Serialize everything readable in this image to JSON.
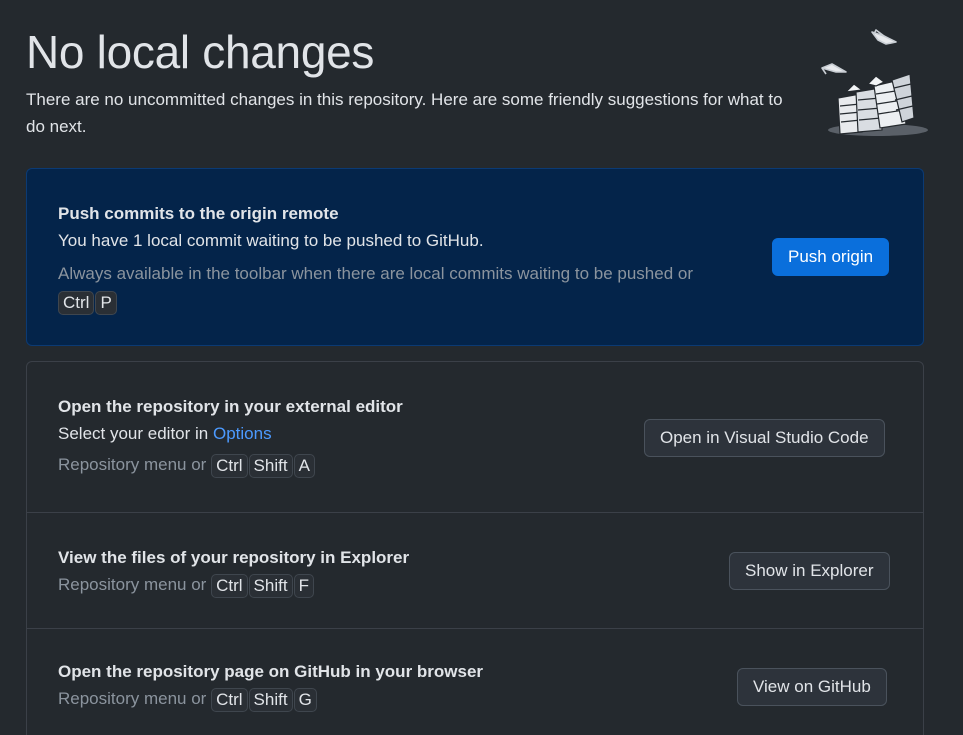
{
  "header": {
    "title": "No local changes",
    "subtitle": "There are no uncommitted changes in this repository. Here are some friendly suggestions for what to do next."
  },
  "push": {
    "heading": "Push commits to the origin remote",
    "description": "You have 1 local commit waiting to be pushed to GitHub.",
    "hint": "Always available in the toolbar when there are local commits waiting to be pushed or",
    "keys": [
      "Ctrl",
      "P"
    ],
    "button_label": "Push origin"
  },
  "editor": {
    "heading": "Open the repository in your external editor",
    "description_prefix": "Select your editor in",
    "options_link": "Options",
    "hint": "Repository menu or",
    "keys": [
      "Ctrl",
      "Shift",
      "A"
    ],
    "button_label": "Open in Visual Studio Code"
  },
  "explorer": {
    "heading": "View the files of your repository in Explorer",
    "hint": "Repository menu or",
    "keys": [
      "Ctrl",
      "Shift",
      "F"
    ],
    "button_label": "Show in Explorer"
  },
  "github": {
    "heading": "Open the repository page on GitHub in your browser",
    "hint": "Repository menu or",
    "keys": [
      "Ctrl",
      "Shift",
      "G"
    ],
    "button_label": "View on GitHub"
  },
  "colors": {
    "background": "#24292e",
    "primary_card": "#04244a",
    "accent_blue": "#0a6fdc",
    "link_blue": "#4c9aff",
    "muted_text": "#8b949e"
  },
  "icons": {
    "illustration": "paper-stacks-illustration"
  }
}
